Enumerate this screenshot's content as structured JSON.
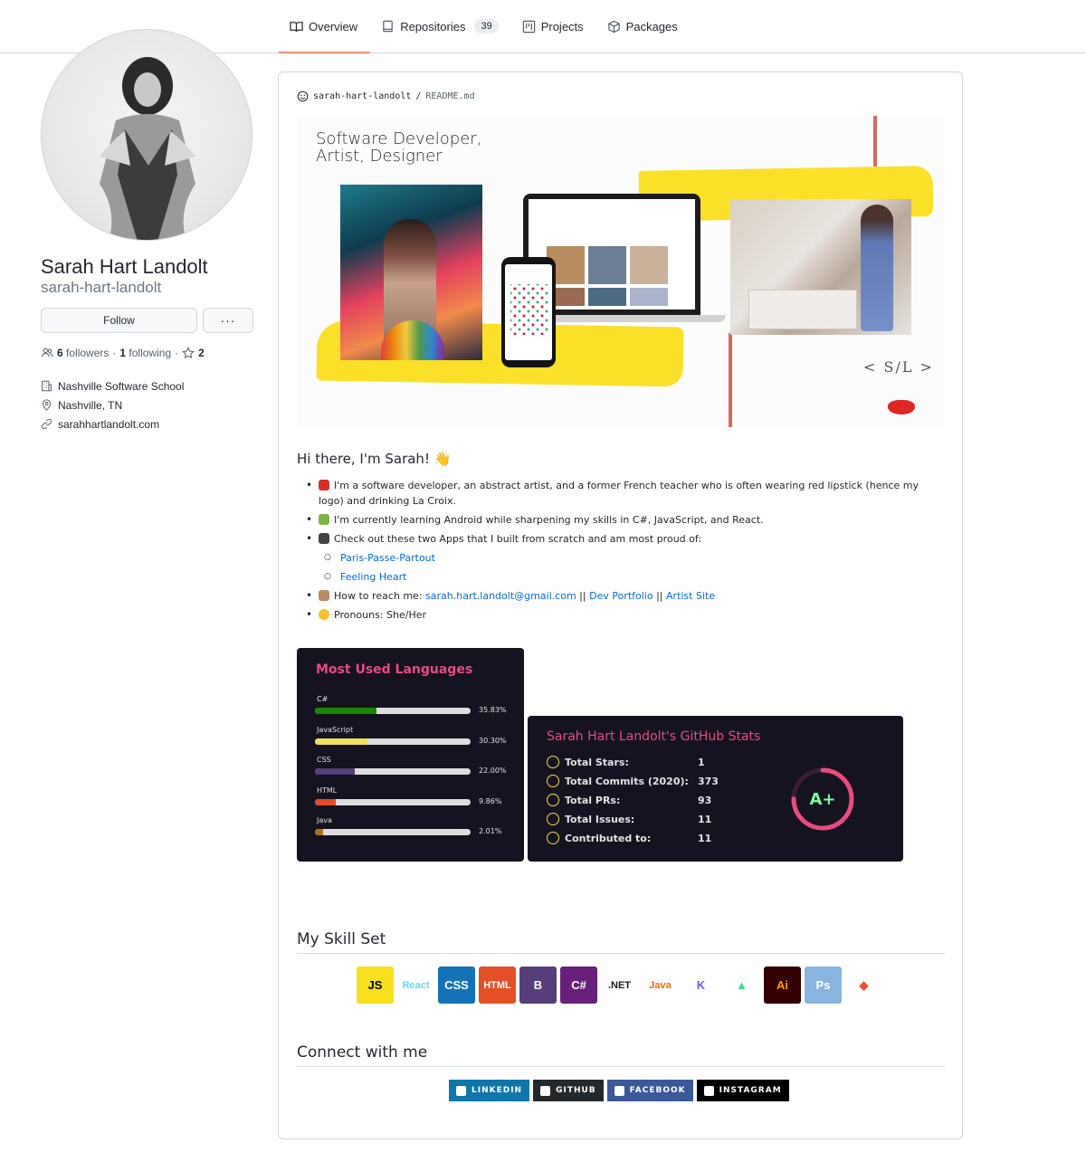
{
  "tabs": [
    {
      "label": "Overview",
      "icon": "book-icon"
    },
    {
      "label": "Repositories",
      "count": "39",
      "icon": "repo-icon"
    },
    {
      "label": "Projects",
      "icon": "project-icon"
    },
    {
      "label": "Packages",
      "icon": "package-icon"
    }
  ],
  "profile": {
    "full_name": "Sarah Hart Landolt",
    "username": "sarah-hart-landolt",
    "follow_label": "Follow",
    "more_label": "···",
    "followers_count": "6",
    "followers_label": "followers",
    "following_count": "1",
    "following_label": "following",
    "stars_count": "2",
    "organization": "Nashville Software School",
    "location": "Nashville, TN",
    "website": "sarahhartlandolt.com"
  },
  "readme": {
    "owner": "sarah-hart-landolt",
    "separator": "/",
    "file": "README.md",
    "banner_title": "Software Developer,\nArtist, Designer",
    "logo_text": "<SHL>",
    "greeting": "Hi there, I'm Sarah! 👋",
    "bullets": {
      "b1": "I'm a software developer, an abstract artist, and a former French teacher who is often wearing red lipstick (hence my logo) and drinking La Croix.",
      "b2": "I'm currently learning Android while sharpening my skills in C#, JavaScript, and React.",
      "b3": "Check out these two Apps that I built from scratch and am most proud of:",
      "app1": "Paris-Passe-Partout",
      "app2": "Feeling Heart",
      "b4_prefix": "How to reach me:",
      "email": "sarah.hart.landolt@gmail.com",
      "sep": "||",
      "dev_portfolio": "Dev Portfolio",
      "artist_site": "Artist Site",
      "b5": "Pronouns: She/Her"
    }
  },
  "languages_card": {
    "title": "Most Used Languages",
    "languages": [
      {
        "name": "C#",
        "pct": "35.83%",
        "value": 35.83,
        "color": "#178600"
      },
      {
        "name": "JavaScript",
        "pct": "30.30%",
        "value": 30.3,
        "color": "#f1e05a"
      },
      {
        "name": "CSS",
        "pct": "22.00%",
        "value": 22.0,
        "color": "#563d7c"
      },
      {
        "name": "HTML",
        "pct": "9.86%",
        "value": 9.86,
        "color": "#e34c26"
      },
      {
        "name": "Java",
        "pct": "2.01%",
        "value": 2.01,
        "color": "#b07219"
      }
    ]
  },
  "stats_card": {
    "title": "Sarah Hart Landolt's GitHub Stats",
    "rows": [
      {
        "label": "Total Stars:",
        "value": "1",
        "icon": "star-icon"
      },
      {
        "label": "Total Commits (2020):",
        "value": "373",
        "icon": "history-icon"
      },
      {
        "label": "Total PRs:",
        "value": "93",
        "icon": "pull-request-icon"
      },
      {
        "label": "Total Issues:",
        "value": "11",
        "icon": "issue-icon"
      },
      {
        "label": "Contributed to:",
        "value": "11",
        "icon": "repo-icon"
      }
    ],
    "grade": "A+",
    "grade_progress": 0.75
  },
  "skills": {
    "heading": "My Skill Set",
    "items": [
      {
        "label": "JS",
        "icon": "javascript-icon",
        "bg": "#f7df1e",
        "fg": "#000000"
      },
      {
        "label": "React",
        "icon": "react-icon",
        "bg": "#ffffff",
        "fg": "#61dafb"
      },
      {
        "label": "CSS",
        "icon": "css3-icon",
        "bg": "#1572b6",
        "fg": "#ffffff"
      },
      {
        "label": "HTML",
        "icon": "html5-icon",
        "bg": "#e34f26",
        "fg": "#ffffff"
      },
      {
        "label": "B",
        "icon": "bootstrap-icon",
        "bg": "#563d7c",
        "fg": "#ffffff"
      },
      {
        "label": "C#",
        "icon": "csharp-icon",
        "bg": "#68217a",
        "fg": "#ffffff"
      },
      {
        "label": ".NET",
        "icon": "dotnet-icon",
        "bg": "#ffffff",
        "fg": "#1a1a1a"
      },
      {
        "label": "Java",
        "icon": "java-icon",
        "bg": "#ffffff",
        "fg": "#e76f00"
      },
      {
        "label": "K",
        "icon": "kotlin-icon",
        "bg": "#ffffff",
        "fg": "#7f52ff"
      },
      {
        "label": "▲",
        "icon": "android-icon",
        "bg": "#ffffff",
        "fg": "#3ddc84"
      },
      {
        "label": "Ai",
        "icon": "illustrator-icon",
        "bg": "#330000",
        "fg": "#ff9a00"
      },
      {
        "label": "Ps",
        "icon": "photoshop-icon",
        "bg": "#8ab4e0",
        "fg": "#ffffff"
      },
      {
        "label": "◆",
        "icon": "git-icon",
        "bg": "#ffffff",
        "fg": "#f05032"
      }
    ]
  },
  "connect": {
    "heading": "Connect with me",
    "badges": [
      {
        "label": "LINKEDIN",
        "bg": "#0e76a8",
        "icon": "linkedin-icon"
      },
      {
        "label": "GITHUB",
        "bg": "#24292e",
        "icon": "github-icon"
      },
      {
        "label": "FACEBOOK",
        "bg": "#3b5998",
        "icon": "facebook-icon"
      },
      {
        "label": "INSTAGRAM",
        "bg": "#000000",
        "icon": "instagram-icon"
      }
    ]
  }
}
